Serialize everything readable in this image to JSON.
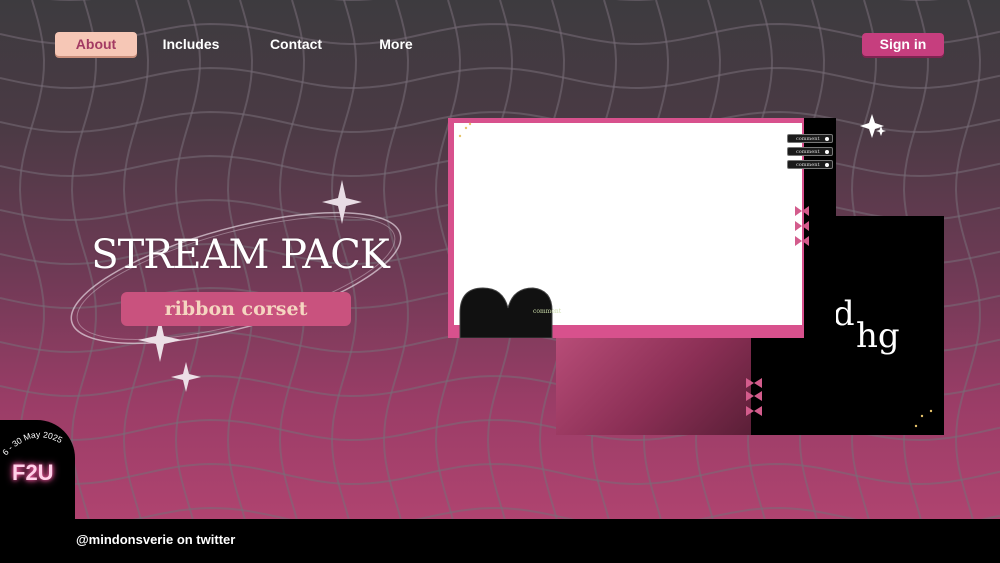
{
  "nav": {
    "about": "About",
    "includes": "Includes",
    "contact": "Contact",
    "more": "More",
    "signin": "Sign in"
  },
  "hero": {
    "title": "STREAM PACK",
    "subtitle": "ribbon corset"
  },
  "mockup": {
    "comments": [
      "comment",
      "comment",
      "comment"
    ],
    "small_comment": "comment",
    "brand_line1": "nd",
    "brand_line2": "hg"
  },
  "badge": {
    "dates": "6 - 30 May 2025",
    "label": "F2U"
  },
  "footer": {
    "credit": "@mindonsverie on twitter"
  },
  "colors": {
    "accent_pink": "#c63e7e",
    "peach": "#f6c7b6",
    "frame_pink": "#d8518d"
  }
}
